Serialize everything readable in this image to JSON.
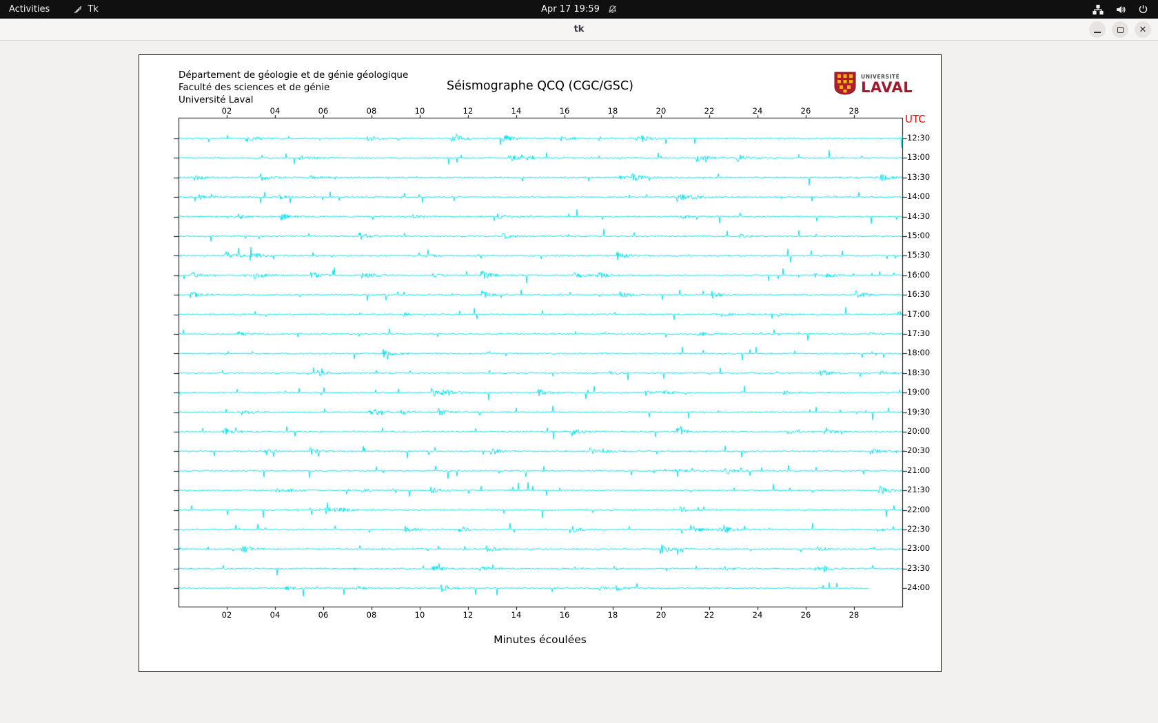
{
  "topbar": {
    "activities_label": "Activities",
    "app_indicator": "Tk",
    "clock": "Apr 17 19:59"
  },
  "window": {
    "title": "tk",
    "controls": {
      "minimize": "minimize",
      "maximize": "maximize",
      "close": "✕"
    }
  },
  "figure": {
    "header_lines": [
      "Département de géologie et de génie géologique",
      "Faculté des sciences et de génie",
      "Université Laval"
    ],
    "title": "Séismographe QCQ (CGC/GSC)",
    "utc_label": "UTC",
    "utc_color": "#ff0000",
    "xlabel": "Minutes écoulées",
    "logo": {
      "line1": "UNIVERSITÉ",
      "line2": "LAVAL",
      "shield_red": "#b01e2e",
      "shield_gold": "#f2b11b"
    }
  },
  "chart_data": {
    "type": "line",
    "title": "Séismographe QCQ (CGC/GSC)",
    "xlabel": "Minutes écoulées",
    "x_range_minutes": [
      0,
      30
    ],
    "x_ticks": [
      "02",
      "04",
      "06",
      "08",
      "10",
      "12",
      "14",
      "16",
      "18",
      "20",
      "22",
      "24",
      "26",
      "28"
    ],
    "row_labels": [
      "12:30",
      "13:00",
      "13:30",
      "14:00",
      "14:30",
      "15:00",
      "15:30",
      "16:00",
      "16:30",
      "17:00",
      "17:30",
      "18:00",
      "18:30",
      "19:00",
      "19:30",
      "20:00",
      "20:30",
      "21:00",
      "21:30",
      "22:00",
      "22:30",
      "23:00",
      "23:30",
      "24:00"
    ],
    "row_label_axis": "UTC",
    "trace_color": "#00E1F0",
    "axis_color": "#000000",
    "last_trace_end_minute": 28.6,
    "grid": false,
    "legend": false
  }
}
